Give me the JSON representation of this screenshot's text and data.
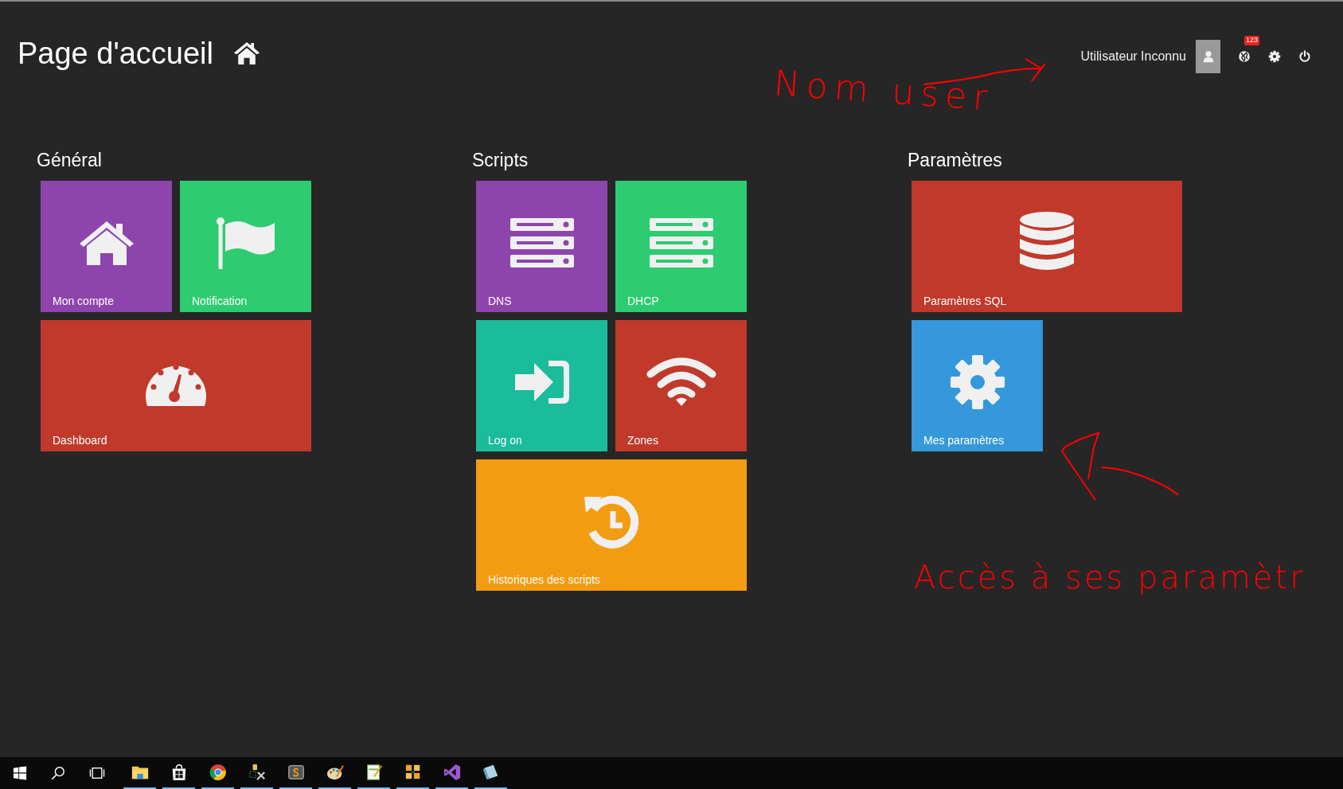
{
  "header": {
    "title": "Page d'accueil",
    "user_name": "Utilisateur Inconnu",
    "notification_badge": "123"
  },
  "sections": [
    {
      "title": "Général",
      "tiles": [
        {
          "label": "Mon compte",
          "kind": "small",
          "color": "#8e44ad"
        },
        {
          "label": "Notification",
          "kind": "small",
          "color": "#2ecc71"
        },
        {
          "label": "Dashboard",
          "kind": "wide",
          "color": "#c0392b"
        }
      ]
    },
    {
      "title": "Scripts",
      "tiles": [
        {
          "label": "DNS",
          "kind": "small",
          "color": "#8e44ad"
        },
        {
          "label": "DHCP",
          "kind": "small",
          "color": "#2ecc71"
        },
        {
          "label": "Log on",
          "kind": "small",
          "color": "#1abc9c"
        },
        {
          "label": "Zones",
          "kind": "small",
          "color": "#c0392b"
        },
        {
          "label": "Historiques des scripts",
          "kind": "wide",
          "color": "#f39c12"
        }
      ]
    },
    {
      "title": "Paramètres",
      "tiles": [
        {
          "label": "Paramètres SQL",
          "kind": "wide",
          "color": "#c0392b"
        },
        {
          "label": "Mes paramètres",
          "kind": "small",
          "color": "#3498db"
        }
      ]
    }
  ],
  "annotations": [
    {
      "text": "Nom user"
    },
    {
      "text": "Accès à ses paramètr"
    }
  ],
  "taskbar": {
    "apps": [
      {
        "running": true
      },
      {
        "running": true
      },
      {
        "running": true
      },
      {
        "running": true
      },
      {
        "running": true
      },
      {
        "running": true
      },
      {
        "running": true
      },
      {
        "running": true
      },
      {
        "running": true
      },
      {
        "running": true
      }
    ]
  }
}
